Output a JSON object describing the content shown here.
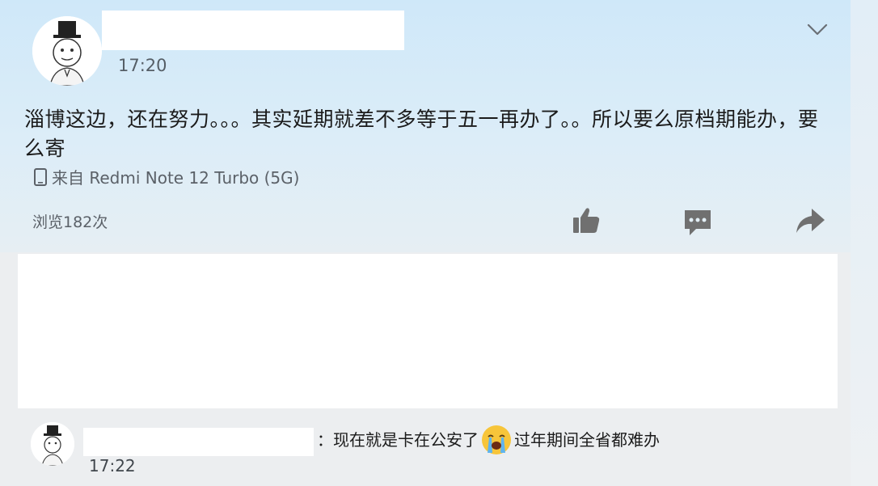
{
  "post": {
    "time": "17:20",
    "text": "淄博这边，还在努力。。。其实延期就差不多等于五一再办了。。所以要么原档期能办，要么寄",
    "source": "来自 Redmi Note 12 Turbo (5G)",
    "views": "浏览182次",
    "icons": {
      "more": "chevron-down-icon",
      "device": "phone-icon",
      "like": "thumbs-up-icon",
      "comment": "comment-bubble-icon",
      "share": "share-arrow-icon"
    }
  },
  "comment": {
    "text_before": "：现在就是卡在公安了",
    "emoji": "crying-face-icon",
    "text_after": "过年期间全省都难办",
    "time": "17:22"
  },
  "colors": {
    "card_gradient_top": "#cfe8f9",
    "icon_gray": "#707070",
    "text_dark": "#1b1b1b",
    "text_muted": "#5b6168"
  }
}
